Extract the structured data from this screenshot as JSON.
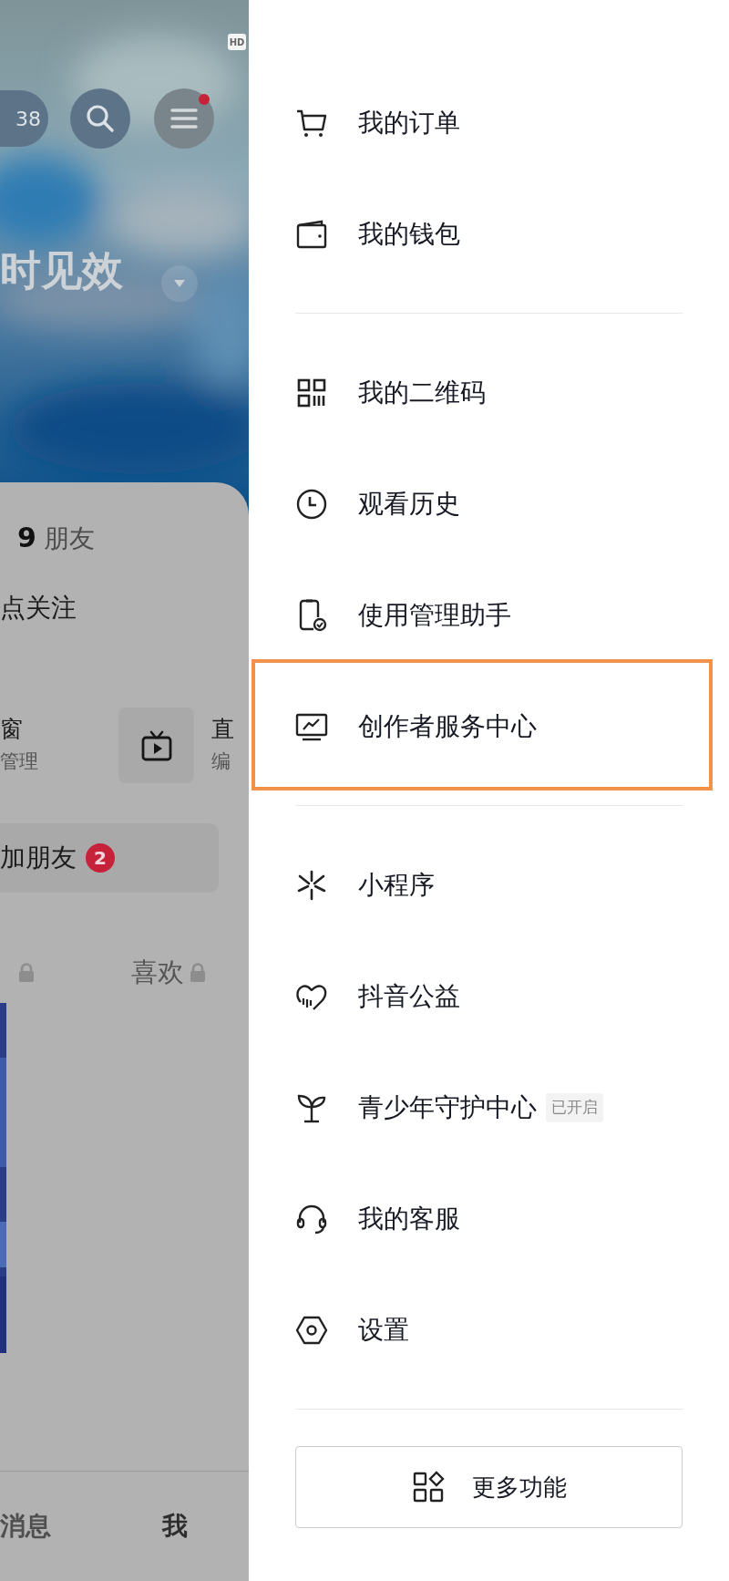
{
  "background_page": {
    "hd_badge": "HD",
    "view_count": "38",
    "notification_dot": true,
    "title": "时见效",
    "stats": {
      "count": "9",
      "label": "朋友"
    },
    "bio": "点关注",
    "shortcuts": [
      {
        "title": "窗",
        "subtitle": "管理",
        "kind": "plain"
      },
      {
        "title": "直",
        "subtitle": "编",
        "kind": "tv"
      }
    ],
    "add_friend": {
      "label": "加朋友",
      "badge": "2"
    },
    "tabs": [
      {
        "locked": true
      },
      {
        "label": "喜欢",
        "locked": true
      }
    ],
    "bottom_nav": [
      {
        "label": "消息",
        "selected": false
      },
      {
        "label": "我",
        "selected": true
      }
    ]
  },
  "drawer": {
    "groups": [
      [
        {
          "label": "我的订单",
          "highlighted": false
        },
        {
          "label": "我的钱包",
          "highlighted": false
        }
      ],
      [
        {
          "label": "我的二维码",
          "highlighted": false
        },
        {
          "label": "观看历史",
          "highlighted": false
        },
        {
          "label": "使用管理助手",
          "highlighted": false
        },
        {
          "label": "创作者服务中心",
          "highlighted": true
        }
      ],
      [
        {
          "label": "小程序",
          "highlighted": false
        },
        {
          "label": "抖音公益",
          "highlighted": false
        },
        {
          "label": "青少年守护中心",
          "tag": "已开启",
          "highlighted": false
        },
        {
          "label": "我的客服",
          "highlighted": false
        },
        {
          "label": "设置",
          "highlighted": false
        }
      ]
    ],
    "more_button": "更多功能"
  }
}
